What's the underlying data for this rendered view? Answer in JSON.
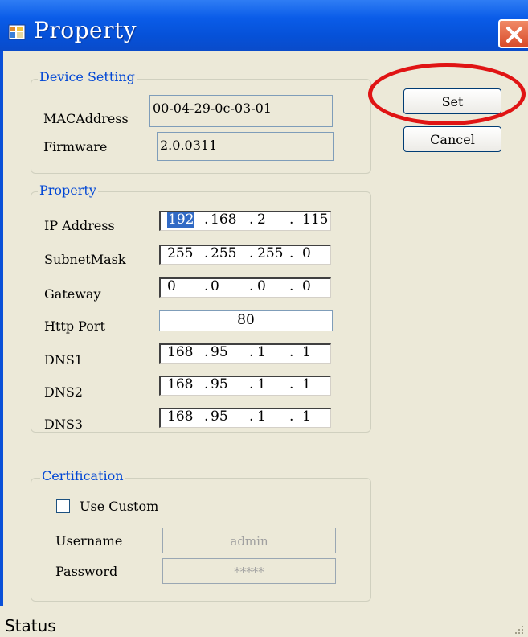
{
  "window": {
    "title": "Property",
    "close_icon": "close-icon",
    "app_icon": "window-app-icon"
  },
  "device_setting": {
    "group_label": "Device Setting",
    "mac_label": "MACAddress",
    "mac_value": "00-04-29-0c-03-01",
    "firmware_label": "Firmware",
    "firmware_value": "2.0.0311"
  },
  "buttons": {
    "set_label": "Set",
    "cancel_label": "Cancel"
  },
  "property": {
    "group_label": "Property",
    "fields": [
      {
        "label": "IP Address",
        "octets": [
          "192",
          "168",
          "2",
          "115"
        ],
        "dots": [
          ".",
          ".",
          "."
        ]
      },
      {
        "label": "SubnetMask",
        "octets": [
          "255",
          "255",
          "255",
          "0"
        ],
        "dots": [
          ".",
          ".",
          "."
        ]
      },
      {
        "label": "Gateway",
        "octets": [
          "0",
          "0",
          "0",
          "0"
        ],
        "dots": [
          ".",
          ".",
          "."
        ]
      },
      {
        "label": "DNS1",
        "octets": [
          "168",
          "95",
          "1",
          "1"
        ],
        "dots": [
          ".",
          ".",
          "."
        ]
      },
      {
        "label": "DNS2",
        "octets": [
          "168",
          "95",
          "1",
          "1"
        ],
        "dots": [
          ".",
          ".",
          "."
        ]
      },
      {
        "label": "DNS3",
        "octets": [
          "168",
          "95",
          "1",
          "1"
        ],
        "dots": [
          ".",
          ".",
          "."
        ]
      }
    ],
    "http_port_label": "Http Port",
    "http_port_value": "80"
  },
  "certification": {
    "group_label": "Certification",
    "use_custom_label": "Use Custom",
    "use_custom_checked": false,
    "username_label": "Username",
    "username_value": "admin",
    "password_label": "Password",
    "password_value": "*****"
  },
  "statusbar": {
    "text": "Status"
  },
  "colors": {
    "title_bar": "#0a5ce8",
    "window_bg": "#ECE9D8",
    "group_label": "#0046d5",
    "highlight": "#e01414",
    "selection": "#316ac5"
  }
}
